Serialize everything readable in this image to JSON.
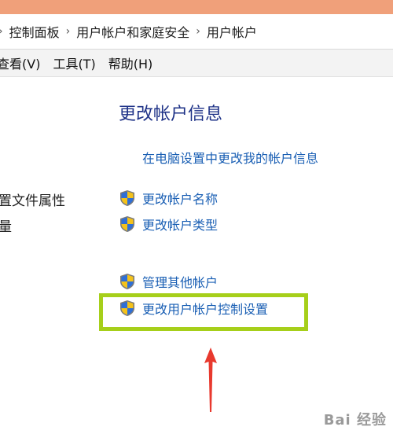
{
  "address": {
    "crumbs": [
      "控制面板",
      "用户帐户和家庭安全",
      "用户帐户"
    ]
  },
  "menu": {
    "items": [
      "查看(V)",
      "工具(T)",
      "帮助(H)"
    ]
  },
  "left_panel": {
    "items": [
      "置文件属性",
      "量"
    ]
  },
  "main": {
    "title": "更改帐户信息",
    "pc_settings_link": "在电脑设置中更改我的帐户信息",
    "tasks": [
      {
        "label": "更改帐户名称",
        "icon": "uac-shield-icon"
      },
      {
        "label": "更改帐户类型",
        "icon": "uac-shield-icon"
      },
      {
        "label": "管理其他帐户",
        "icon": "uac-shield-icon"
      },
      {
        "label": "更改用户帐户控制设置",
        "icon": "uac-shield-icon"
      }
    ]
  },
  "annotation": {
    "highlight_color": "#a6cf1a",
    "arrow_color": "#e8392e"
  },
  "watermark": {
    "text": "Bai 经验"
  },
  "colors": {
    "title": "#1e3287",
    "link": "#1a5fb4",
    "titlebar": "#f0a07a"
  }
}
